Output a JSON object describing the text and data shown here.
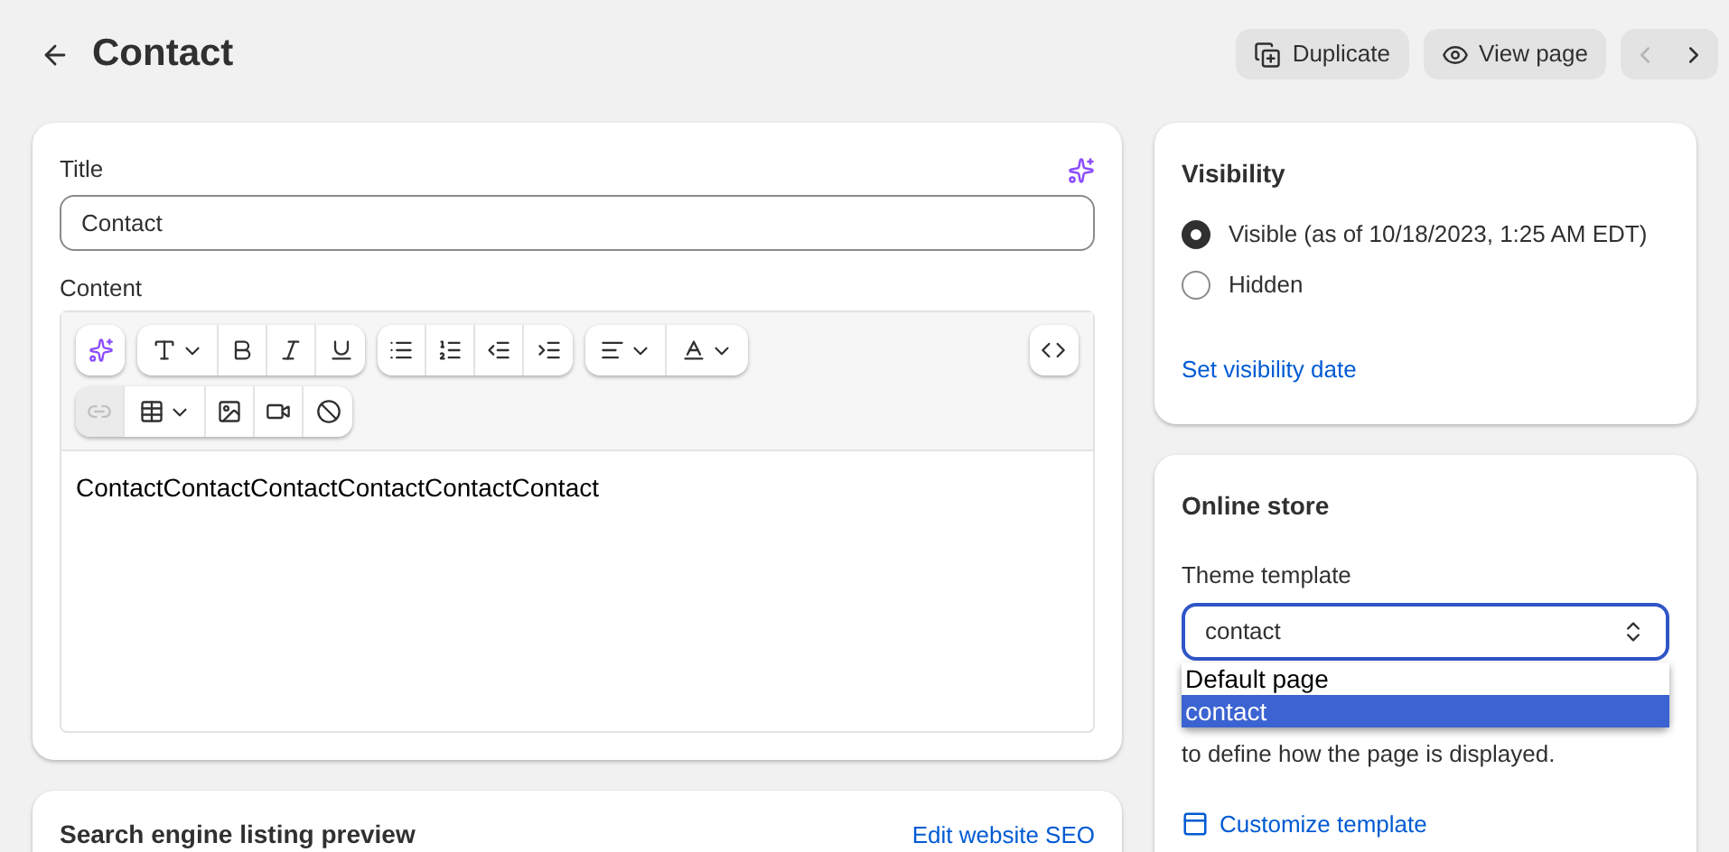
{
  "header": {
    "title": "Contact",
    "actions": [
      {
        "kind": "duplicate",
        "label": "Duplicate"
      },
      {
        "kind": "view",
        "label": "View page"
      }
    ],
    "nav": {
      "prev_disabled": true,
      "next_disabled": false
    }
  },
  "editor_card": {
    "title_label": "Title",
    "title_value": "Contact",
    "content_label": "Content",
    "toolbar_rows": [
      [
        {
          "buttons": [
            {
              "kind": "sparkles",
              "dropdown": false,
              "disabled": false
            }
          ]
        },
        {
          "buttons": [
            {
              "kind": "font",
              "dropdown": true,
              "disabled": false
            },
            {
              "kind": "bold",
              "dropdown": false,
              "disabled": false
            },
            {
              "kind": "italic",
              "dropdown": false,
              "disabled": false
            },
            {
              "kind": "underline",
              "dropdown": false,
              "disabled": false
            }
          ]
        },
        {
          "buttons": [
            {
              "kind": "bullets",
              "dropdown": false,
              "disabled": false
            },
            {
              "kind": "numbers",
              "dropdown": false,
              "disabled": false
            },
            {
              "kind": "outdent",
              "dropdown": false,
              "disabled": false
            },
            {
              "kind": "indent",
              "dropdown": false,
              "disabled": false
            }
          ]
        },
        {
          "buttons": [
            {
              "kind": "align",
              "dropdown": true,
              "disabled": false
            },
            {
              "kind": "color",
              "dropdown": true,
              "disabled": false
            }
          ]
        },
        {
          "buttons": [
            {
              "kind": "code",
              "dropdown": false,
              "disabled": false
            }
          ],
          "right": true
        }
      ],
      [
        {
          "buttons": [
            {
              "kind": "link",
              "dropdown": false,
              "disabled": true
            },
            {
              "kind": "table",
              "dropdown": true,
              "disabled": false
            },
            {
              "kind": "image",
              "dropdown": false,
              "disabled": false
            },
            {
              "kind": "video",
              "dropdown": false,
              "disabled": false
            },
            {
              "kind": "clear",
              "dropdown": false,
              "disabled": false
            }
          ]
        }
      ]
    ],
    "content": "ContactContactContactContactContactContact"
  },
  "seo_card": {
    "title": "Search engine listing preview",
    "link": "Edit website SEO"
  },
  "visibility": {
    "title": "Visibility",
    "options": [
      {
        "label": "Visible (as of 10/18/2023, 1:25 AM EDT)",
        "selected": true
      },
      {
        "label": "Hidden",
        "selected": false
      }
    ],
    "link": "Set visibility date"
  },
  "online_store": {
    "title": "Online store",
    "field_label": "Theme template",
    "value": "contact",
    "options": [
      {
        "label": "Default page",
        "selected": false
      },
      {
        "label": "contact",
        "selected": true
      }
    ],
    "help_text": "to define how the page is displayed.",
    "link": "Customize template"
  }
}
